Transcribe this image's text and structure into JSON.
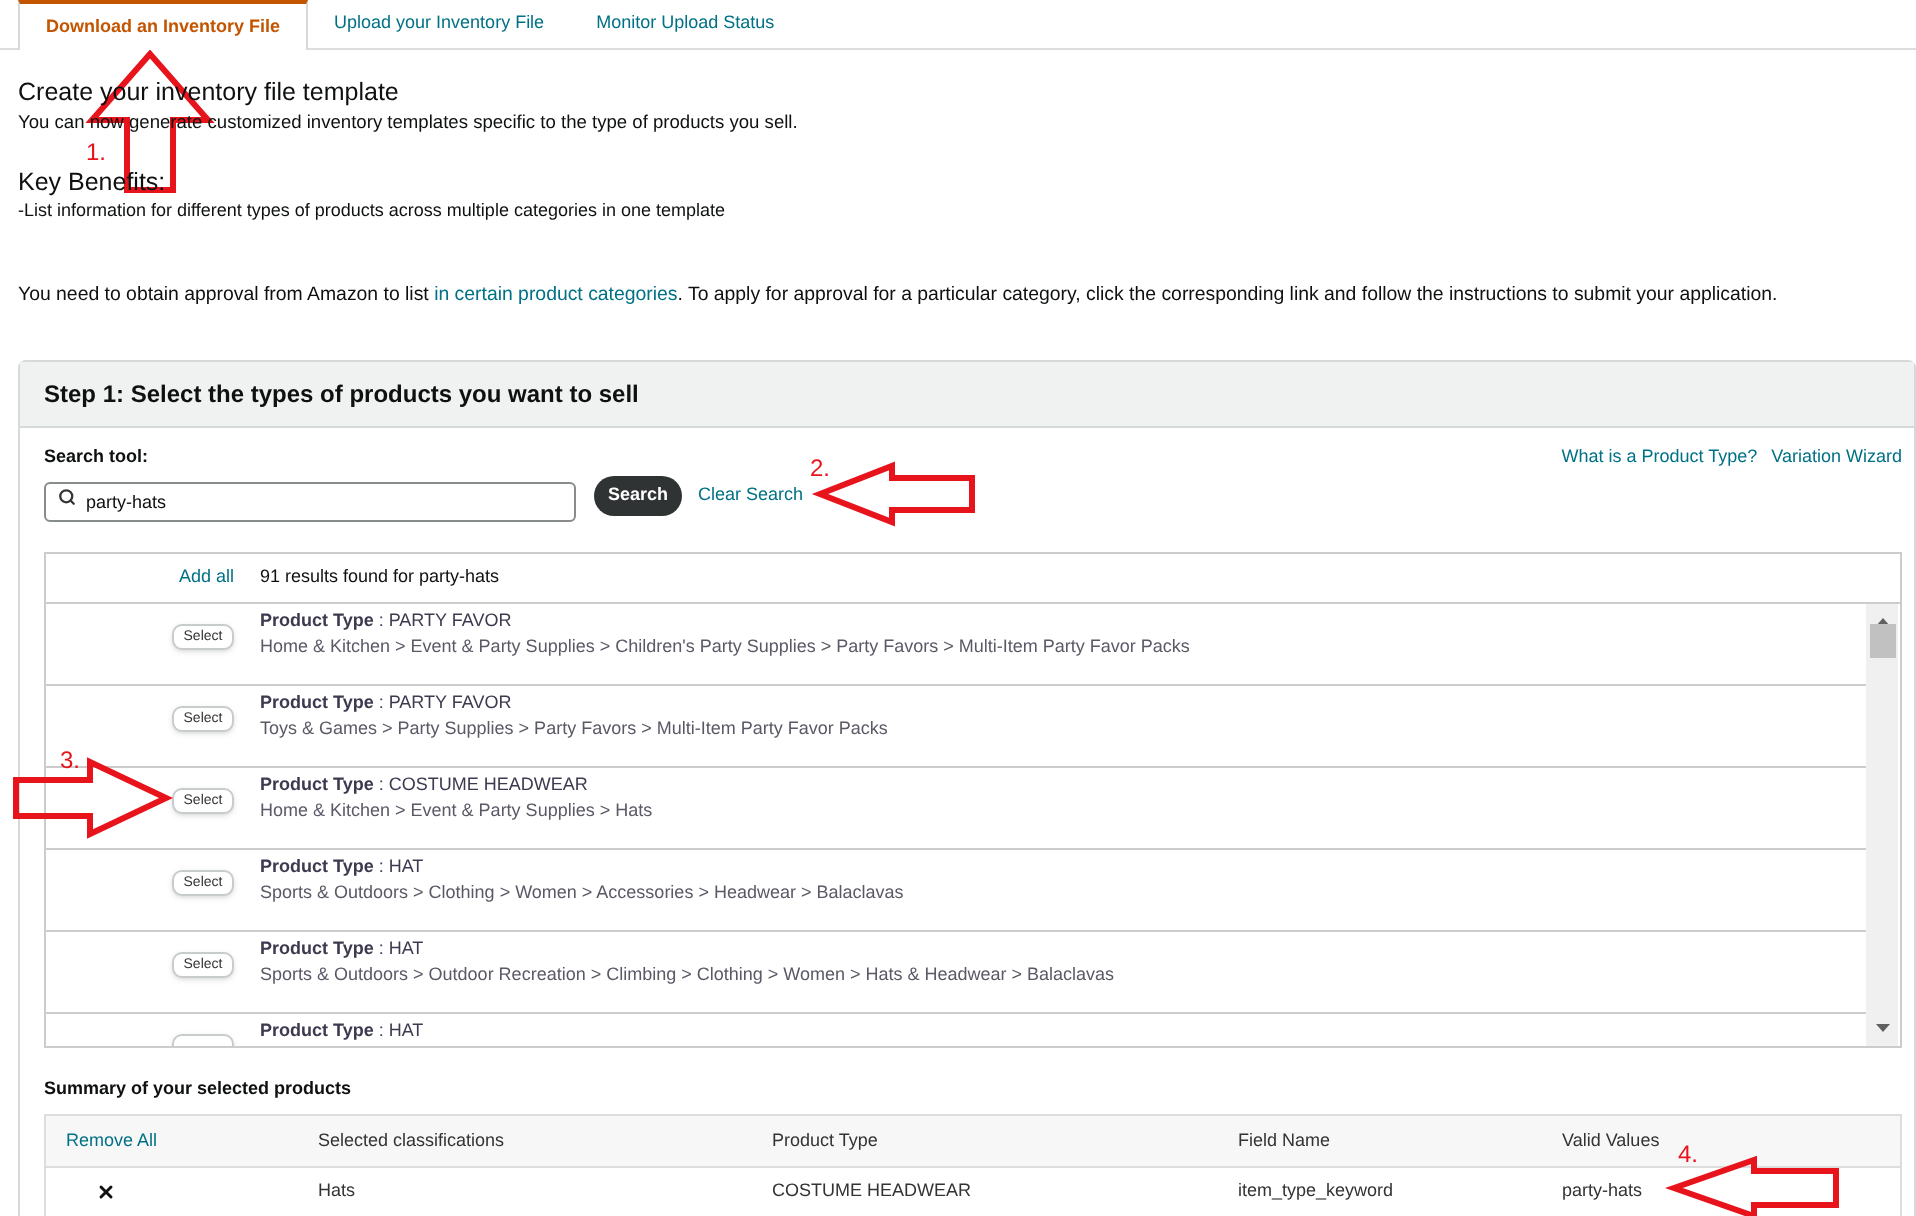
{
  "tabs": [
    {
      "label": "Download an Inventory File",
      "selected": true
    },
    {
      "label": "Upload your Inventory File",
      "selected": false
    },
    {
      "label": "Monitor Upload Status",
      "selected": false
    }
  ],
  "intro": {
    "title": "Create your inventory file template",
    "text": "You can now generate customized inventory templates specific to the type of products you sell."
  },
  "benefits": {
    "title": "Key Benefits:",
    "items": [
      "-List information for different types of products across multiple categories in one template"
    ]
  },
  "approval_note": {
    "before": "You need to obtain approval from Amazon to list ",
    "link": "in certain product categories",
    "after": ". To apply for approval for a particular category, click the corresponding link and follow the instructions to submit your application."
  },
  "step1": {
    "title": "Step 1: Select the types of products you want to sell",
    "search_label": "Search tool:",
    "search_value": "party-hats",
    "search_button": "Search",
    "clear_link": "Clear Search",
    "help_links": [
      "What is a Product Type?",
      "Variation Wizard"
    ],
    "results": {
      "add_all": "Add all",
      "count_text": "91 results found for party-hats",
      "rows": [
        {
          "select_label": "Select",
          "heading": "**Product Type** : PARTY FAVOR",
          "path": "Home & Kitchen > Event & Party Supplies > Children's Party Supplies > Party Favors > Multi-Item Party Favor Packs"
        },
        {
          "select_label": "Select",
          "heading": "**Product Type** : PARTY FAVOR",
          "path": "Toys & Games > Party Supplies > Party Favors > Multi-Item Party Favor Packs"
        },
        {
          "select_label": "Select",
          "heading": "**Product Type** : COSTUME HEADWEAR",
          "path": "Home & Kitchen > Event & Party Supplies > Hats"
        },
        {
          "select_label": "Select",
          "heading": "**Product Type** : HAT",
          "path": "Sports & Outdoors > Clothing > Women > Accessories > Headwear > Balaclavas"
        },
        {
          "select_label": "Select",
          "heading": "**Product Type** : HAT",
          "path": "Sports & Outdoors > Outdoor Recreation > Climbing > Clothing > Women > Hats & Headwear > Balaclavas"
        },
        {
          "heading": "**Product Type** : HAT"
        }
      ]
    }
  },
  "summary": {
    "title": "Summary of your selected products",
    "remove_all": "Remove All",
    "columns": [
      "Selected classifications",
      "Product Type",
      "Field Name",
      "Valid Values"
    ],
    "rows": [
      {
        "cells": [
          "Hats",
          "COSTUME HEADWEAR",
          "item_type_keyword",
          "party-hats"
        ]
      }
    ]
  },
  "annotations": [
    {
      "label": "1.",
      "kind": "up"
    },
    {
      "label": "2.",
      "kind": "left"
    },
    {
      "label": "3.",
      "kind": "right"
    },
    {
      "label": "4.",
      "kind": "left"
    }
  ]
}
